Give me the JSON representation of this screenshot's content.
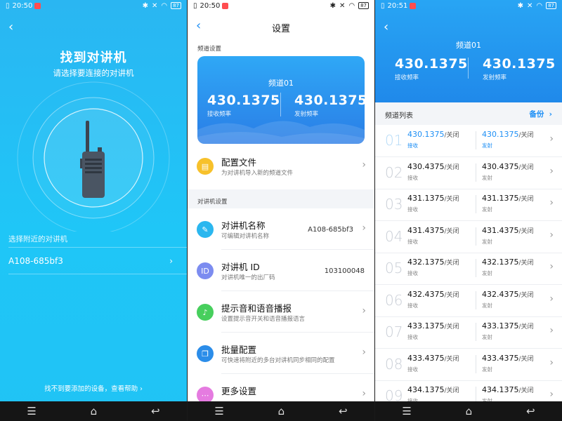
{
  "status_bar": [
    {
      "time": "20:50",
      "battery": "87"
    },
    {
      "time": "20:50",
      "battery": "87"
    },
    {
      "time": "20:51",
      "battery": "87"
    }
  ],
  "screen1": {
    "title": "找到对讲机",
    "subtitle": "请选择要连接的对讲机",
    "section_label": "选择附近的对讲机",
    "device_name": "A108-685bf3",
    "help_text": "找不到要添加的设备，查看帮助 ›"
  },
  "screen2": {
    "header_title": "设置",
    "channel_section_label": "频道设置",
    "card": {
      "channel_name": "频道01",
      "rx_freq": "430.1375",
      "rx_label": "接收频率",
      "tx_freq": "430.1375",
      "tx_label": "发射频率"
    },
    "config_file": {
      "title": "配置文件",
      "desc": "为对讲机导入新的频道文件"
    },
    "device_section_label": "对讲机设置",
    "items": [
      {
        "title": "对讲机名称",
        "desc": "可编辑对讲机名称",
        "value": "A108-685bf3",
        "icon": "pencil-icon",
        "color": "#2bb7ef"
      },
      {
        "title": "对讲机 ID",
        "desc": "对讲机唯一的出厂码",
        "value": "103100048",
        "icon": "id-icon",
        "color": "#7c8cf0"
      },
      {
        "title": "提示音和语音播报",
        "desc": "设置提示音开关和语音播报语言",
        "value": "",
        "icon": "bell-icon",
        "color": "#47cf5d"
      },
      {
        "title": "批量配置",
        "desc": "可快速将附近的多台对讲机同步相同的配置",
        "value": "",
        "icon": "copy-icon",
        "color": "#2b8de9"
      },
      {
        "title": "更多设置",
        "desc": "",
        "value": "",
        "icon": "more-icon",
        "color": "#e57be0"
      }
    ]
  },
  "screen3": {
    "channel_name": "频道01",
    "rx_freq": "430.1375",
    "rx_label": "接收频率",
    "tx_freq": "430.1375",
    "tx_label": "发射频率",
    "list_title": "频道列表",
    "backup_label": "备份",
    "rx_row_label": "接收",
    "tx_row_label": "发射",
    "off_suffix": "/关闭",
    "channels": [
      {
        "num": "01",
        "rx": "430.1375",
        "tx": "430.1375"
      },
      {
        "num": "02",
        "rx": "430.4375",
        "tx": "430.4375"
      },
      {
        "num": "03",
        "rx": "431.1375",
        "tx": "431.1375"
      },
      {
        "num": "04",
        "rx": "431.4375",
        "tx": "431.4375"
      },
      {
        "num": "05",
        "rx": "432.1375",
        "tx": "432.1375"
      },
      {
        "num": "06",
        "rx": "432.4375",
        "tx": "432.4375"
      },
      {
        "num": "07",
        "rx": "433.1375",
        "tx": "433.1375"
      },
      {
        "num": "08",
        "rx": "433.4375",
        "tx": "433.4375"
      },
      {
        "num": "09",
        "rx": "434.1375",
        "tx": "434.1375"
      }
    ]
  },
  "colors": {
    "accent": "#1e8ff5",
    "sky": "#2ab6f2"
  }
}
